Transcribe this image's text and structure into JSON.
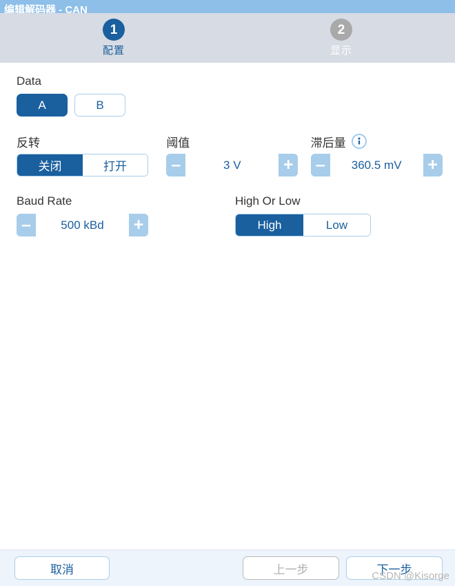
{
  "window": {
    "title": "编辑解码器 - CAN"
  },
  "steps": [
    {
      "number": "1",
      "label": "配置",
      "state": "active"
    },
    {
      "number": "2",
      "label": "显示",
      "state": "inactive"
    }
  ],
  "form": {
    "data": {
      "label": "Data",
      "options": [
        {
          "label": "A",
          "selected": true
        },
        {
          "label": "B",
          "selected": false
        }
      ]
    },
    "invert": {
      "label": "反转",
      "options": [
        {
          "label": "关闭",
          "selected": true
        },
        {
          "label": "打开",
          "selected": false
        }
      ]
    },
    "threshold": {
      "label": "阈值",
      "value": "3 V",
      "minus": "–",
      "plus": "+"
    },
    "hysteresis": {
      "label": "滞后量",
      "info_icon": "info-icon",
      "value": "360.5 mV",
      "minus": "–",
      "plus": "+"
    },
    "baud_rate": {
      "label": "Baud Rate",
      "value": "500 kBd",
      "minus": "–",
      "plus": "+"
    },
    "high_or_low": {
      "label": "High Or Low",
      "options": [
        {
          "label": "High",
          "selected": true
        },
        {
          "label": "Low",
          "selected": false
        }
      ]
    }
  },
  "footer": {
    "cancel": "取消",
    "previous": "上一步",
    "next": "下一步"
  },
  "watermark": "CSDN @Kisorge",
  "colors": {
    "titlebar": "#8dbfe8",
    "stepbar": "#d7dbe3",
    "accent_dark_blue": "#1a5f9e",
    "accent_light_blue": "#a8cdeb",
    "inactive_gray": "#a9a9a9",
    "footer_bg": "#eef4fb"
  }
}
